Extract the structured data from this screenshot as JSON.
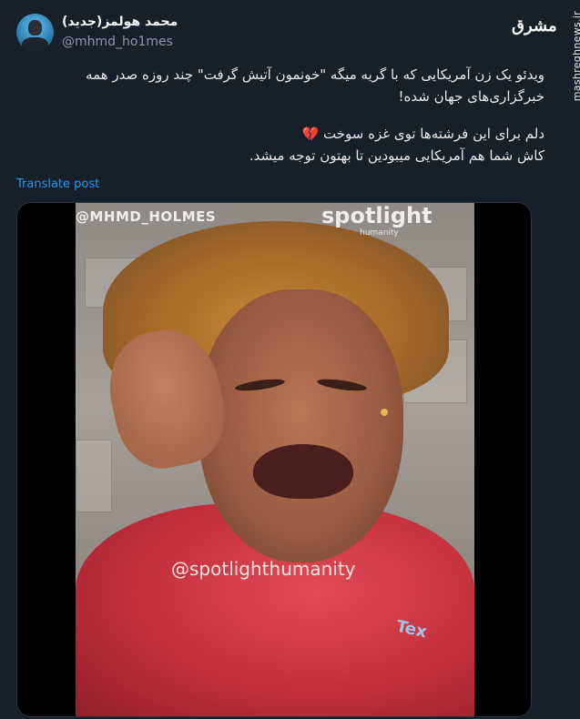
{
  "user": {
    "display_name": "محمد هولمز(جدید)",
    "handle": "@mhmd_ho1mes"
  },
  "watermark": {
    "logo_text": "مشرق",
    "site": "mashreghnews.ir"
  },
  "tweet": {
    "paragraph_1": "ویدئو یک زن آمریکایی که با گریه میگه \"خونمون آتیش گرفت\" چند روزه صدر همه خبرگزاری‌های جهان شده!",
    "paragraph_2_line_1": "دلم برای این فرشته‌ها توی غزه سوخت 💔",
    "paragraph_2_line_2": "کاش شما هم آمریکایی میبودین تا بهتون توجه میشد."
  },
  "translate_label": "Translate post",
  "media": {
    "overlay_handle": "@MHMD_HOLMES",
    "overlay_brand": "spotlight",
    "overlay_brand_sub": "humanity",
    "overlay_credit": "@spotlighthumanity",
    "shirt_text": "Tex"
  },
  "colors": {
    "background": "#15202b",
    "link": "#1d9bf0",
    "secondary_text": "#8b98a5"
  }
}
